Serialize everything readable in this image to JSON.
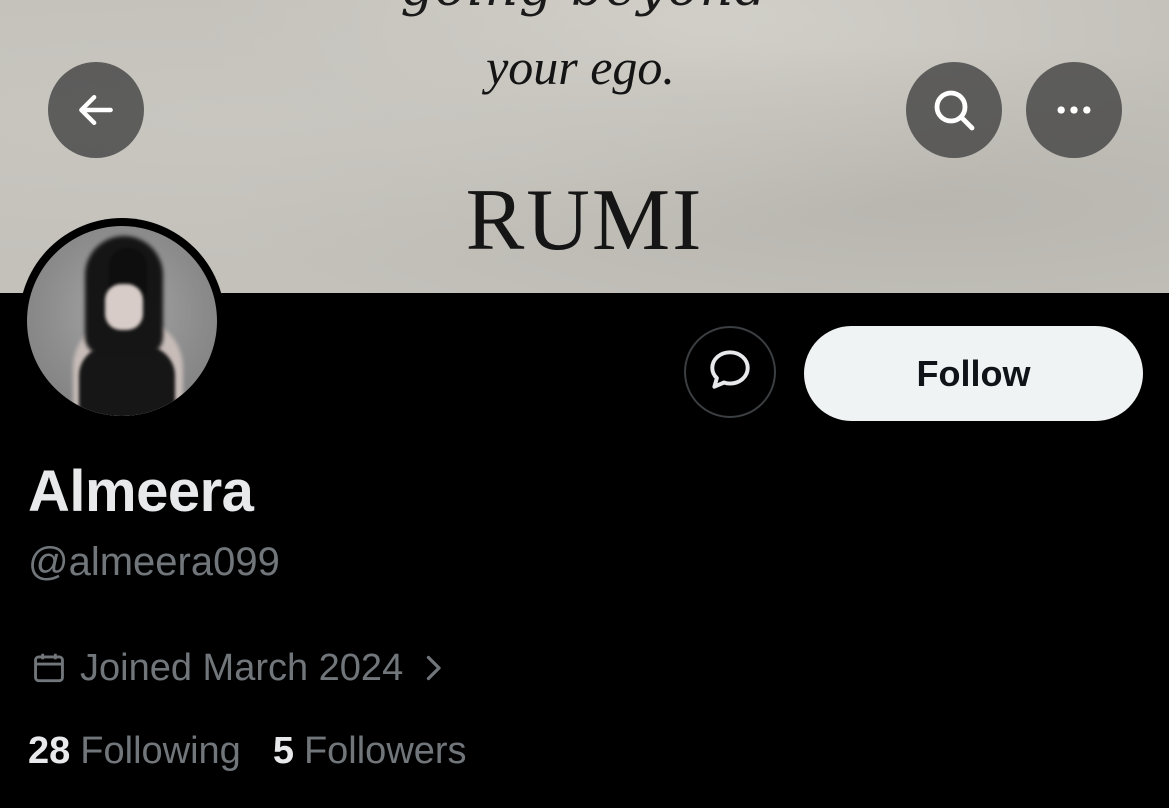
{
  "banner": {
    "line1": "going beyond",
    "line2": "your ego.",
    "author": "RUMI"
  },
  "toolbar": {
    "back_icon": "arrow-left-icon",
    "search_icon": "search-icon",
    "more_icon": "more-horizontal-icon"
  },
  "profile": {
    "display_name": "Almeera",
    "handle": "@almeera099",
    "joined": "Joined March 2024",
    "following_count": "28",
    "following_label": "Following",
    "followers_count": "5",
    "followers_label": "Followers"
  },
  "actions": {
    "message_icon": "message-bubble-icon",
    "follow_label": "Follow"
  },
  "colors": {
    "background": "#000000",
    "primary_text": "#e7e9ea",
    "secondary_text": "#71767b",
    "follow_bg": "#eff3f4",
    "follow_text": "#0f1419"
  }
}
